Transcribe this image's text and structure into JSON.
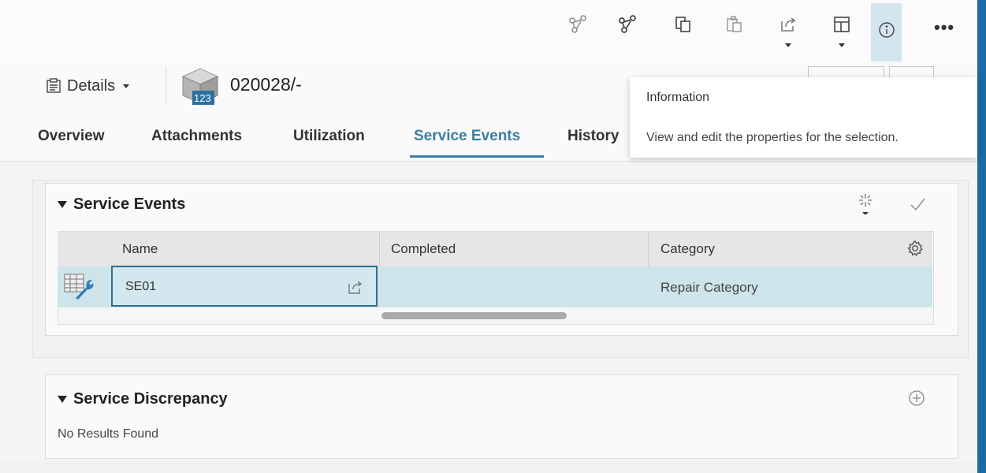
{
  "toolbar": {
    "icons": [
      "branch-icon",
      "branch-bold-icon",
      "copy-icon",
      "paste-icon",
      "share-icon",
      "layout-icon",
      "info-icon",
      "more-icon"
    ],
    "more_label": "•••"
  },
  "header": {
    "details_label": "Details",
    "object_icon_badge": "123",
    "object_title": "020028/-"
  },
  "tabs": [
    {
      "label": "Overview"
    },
    {
      "label": "Attachments"
    },
    {
      "label": "Utilization"
    },
    {
      "label": "Service Events",
      "active": true
    },
    {
      "label": "History"
    }
  ],
  "tooltip": {
    "title": "Information",
    "description": "View and edit the properties for the selection."
  },
  "service_events": {
    "title": "Service Events",
    "columns": [
      "Name",
      "Completed",
      "Category"
    ],
    "rows": [
      {
        "name": "SE01",
        "completed": "",
        "category": "Repair Category"
      }
    ]
  },
  "service_discrepancy": {
    "title": "Service Discrepancy",
    "empty_message": "No Results Found"
  },
  "colors": {
    "accent": "#3a7ea6",
    "selection": "#cde4ea",
    "rail": "#1d6aa5"
  }
}
